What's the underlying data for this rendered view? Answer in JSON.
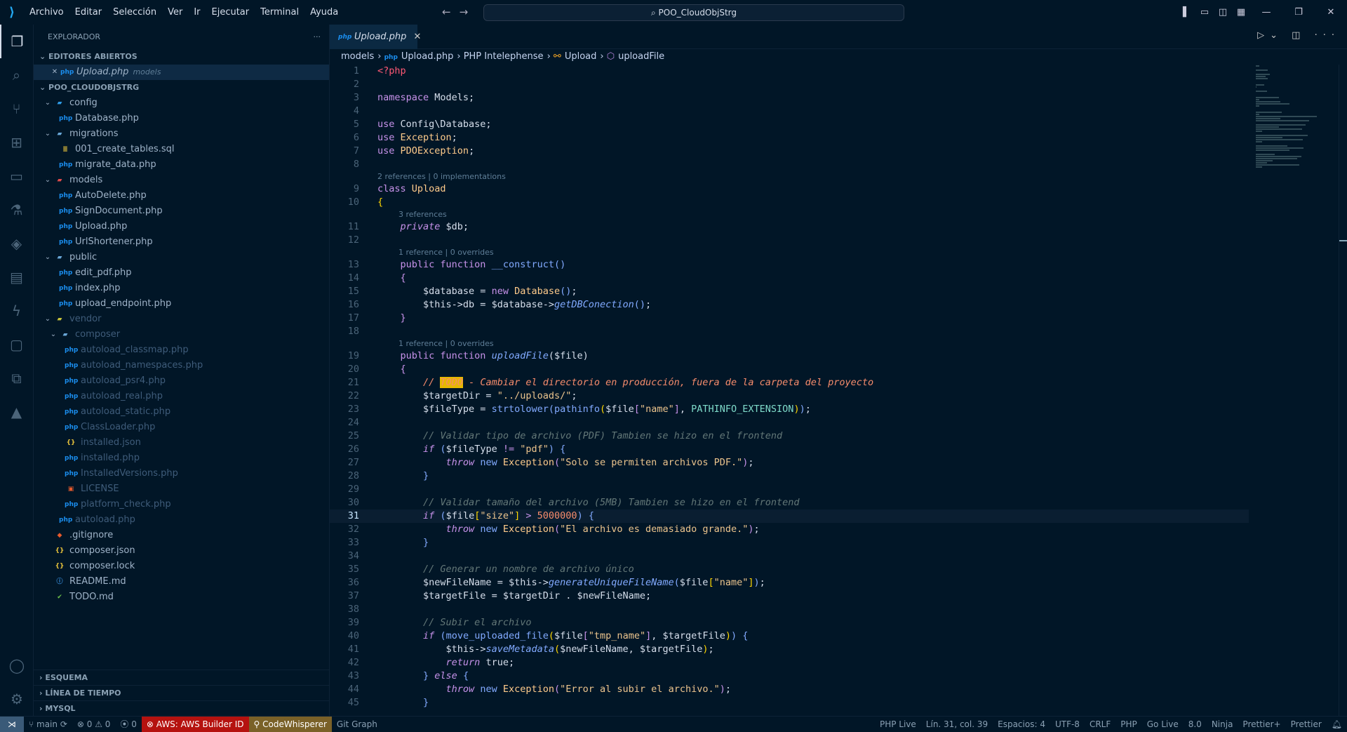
{
  "titlebar": {
    "menu": [
      "Archivo",
      "Editar",
      "Selección",
      "Ver",
      "Ir",
      "Ejecutar",
      "Terminal",
      "Ayuda"
    ],
    "search": "POO_CloudObjStrg"
  },
  "sidebar": {
    "title": "EXPLORADOR",
    "open_editors": {
      "label": "EDITORES ABIERTOS",
      "items": [
        {
          "name": "Upload.php",
          "hint": "models"
        }
      ]
    },
    "project": "POO_CLOUDOBJSTRG",
    "tree": [
      {
        "d": 1,
        "t": "folder",
        "name": "config",
        "open": true,
        "icon": "folder-config"
      },
      {
        "d": 2,
        "t": "php",
        "name": "Database.php"
      },
      {
        "d": 1,
        "t": "folder",
        "name": "migrations",
        "open": true
      },
      {
        "d": 2,
        "t": "sql",
        "name": "001_create_tables.sql"
      },
      {
        "d": 2,
        "t": "php",
        "name": "migrate_data.php"
      },
      {
        "d": 1,
        "t": "folder",
        "name": "models",
        "open": true
      },
      {
        "d": 2,
        "t": "php",
        "name": "AutoDelete.php"
      },
      {
        "d": 2,
        "t": "php",
        "name": "SignDocument.php"
      },
      {
        "d": 2,
        "t": "php",
        "name": "Upload.php"
      },
      {
        "d": 2,
        "t": "php",
        "name": "UrlShortener.php"
      },
      {
        "d": 1,
        "t": "folder",
        "name": "public",
        "open": true
      },
      {
        "d": 2,
        "t": "php",
        "name": "edit_pdf.php"
      },
      {
        "d": 2,
        "t": "php",
        "name": "index.php"
      },
      {
        "d": 2,
        "t": "php",
        "name": "upload_endpoint.php"
      },
      {
        "d": 1,
        "t": "folder",
        "name": "vendor",
        "open": true,
        "dim": true
      },
      {
        "d": 2,
        "t": "folder",
        "name": "composer",
        "open": true,
        "dim": true
      },
      {
        "d": 3,
        "t": "php",
        "name": "autoload_classmap.php",
        "dim": true
      },
      {
        "d": 3,
        "t": "php",
        "name": "autoload_namespaces.php",
        "dim": true
      },
      {
        "d": 3,
        "t": "php",
        "name": "autoload_psr4.php",
        "dim": true
      },
      {
        "d": 3,
        "t": "php",
        "name": "autoload_real.php",
        "dim": true
      },
      {
        "d": 3,
        "t": "php",
        "name": "autoload_static.php",
        "dim": true
      },
      {
        "d": 3,
        "t": "php",
        "name": "ClassLoader.php",
        "dim": true
      },
      {
        "d": 3,
        "t": "json",
        "name": "installed.json",
        "dim": true
      },
      {
        "d": 3,
        "t": "php",
        "name": "installed.php",
        "dim": true
      },
      {
        "d": 3,
        "t": "php",
        "name": "InstalledVersions.php",
        "dim": true
      },
      {
        "d": 3,
        "t": "lic",
        "name": "LICENSE",
        "dim": true
      },
      {
        "d": 3,
        "t": "php",
        "name": "platform_check.php",
        "dim": true
      },
      {
        "d": 2,
        "t": "php",
        "name": "autoload.php",
        "dim": true
      },
      {
        "d": 1,
        "t": "git",
        "name": ".gitignore"
      },
      {
        "d": 1,
        "t": "json",
        "name": "composer.json"
      },
      {
        "d": 1,
        "t": "json",
        "name": "composer.lock"
      },
      {
        "d": 1,
        "t": "info",
        "name": "README.md"
      },
      {
        "d": 1,
        "t": "todo",
        "name": "TODO.md"
      }
    ],
    "bottom_sections": [
      "ESQUEMA",
      "LÍNEA DE TIEMPO",
      "MYSQL"
    ]
  },
  "editor": {
    "tab": "Upload.php",
    "breadcrumb": [
      "models",
      "Upload.php",
      "PHP Intelephense",
      "Upload",
      "uploadFile"
    ],
    "current_line": 31,
    "lines": [
      {
        "n": 1,
        "t": [
          [
            "tag",
            "<?php"
          ]
        ]
      },
      {
        "n": 2,
        "t": []
      },
      {
        "n": 3,
        "t": [
          [
            "kw",
            "namespace "
          ],
          [
            "var",
            "Models;"
          ]
        ]
      },
      {
        "n": 4,
        "t": []
      },
      {
        "n": 5,
        "t": [
          [
            "kw",
            "use "
          ],
          [
            "var",
            "Config\\Database;"
          ]
        ]
      },
      {
        "n": 6,
        "t": [
          [
            "kw",
            "use "
          ],
          [
            "cls",
            "Exception"
          ],
          [
            "p",
            ";"
          ]
        ]
      },
      {
        "n": 7,
        "t": [
          [
            "kw",
            "use "
          ],
          [
            "cls",
            "PDOException"
          ],
          [
            "p",
            ";"
          ]
        ]
      },
      {
        "n": 8,
        "t": []
      },
      {
        "lens": "2 references | 0 implementations",
        "i": 0
      },
      {
        "n": 9,
        "t": [
          [
            "kw",
            "class "
          ],
          [
            "cls",
            "Upload"
          ]
        ]
      },
      {
        "n": 10,
        "t": [
          [
            "b2",
            "{"
          ]
        ]
      },
      {
        "lens": "3 references",
        "i": 1
      },
      {
        "n": 11,
        "t": [
          [
            "p",
            "    "
          ],
          [
            "kwi",
            "private "
          ],
          [
            "var",
            "$db;"
          ]
        ]
      },
      {
        "n": 12,
        "t": []
      },
      {
        "lens": "1 reference | 0 overrides",
        "i": 1
      },
      {
        "n": 13,
        "t": [
          [
            "p",
            "    "
          ],
          [
            "kw",
            "public function "
          ],
          [
            "fn",
            "__construct"
          ],
          [
            "b",
            "()"
          ]
        ]
      },
      {
        "n": 14,
        "t": [
          [
            "p",
            "    "
          ],
          [
            "kw",
            "{"
          ]
        ]
      },
      {
        "n": 15,
        "t": [
          [
            "p",
            "        "
          ],
          [
            "var",
            "$database = "
          ],
          [
            "kw",
            "new "
          ],
          [
            "cls",
            "Database"
          ],
          [
            "b",
            "()"
          ],
          [
            "p",
            ";"
          ]
        ]
      },
      {
        "n": 16,
        "t": [
          [
            "p",
            "        "
          ],
          [
            "var",
            "$this->db = $database->"
          ],
          [
            "fni",
            "getDBConection"
          ],
          [
            "b",
            "()"
          ],
          [
            "p",
            ";"
          ]
        ]
      },
      {
        "n": 17,
        "t": [
          [
            "p",
            "    "
          ],
          [
            "kw",
            "}"
          ]
        ]
      },
      {
        "n": 18,
        "t": []
      },
      {
        "lens": "1 reference | 0 overrides",
        "i": 1
      },
      {
        "n": 19,
        "t": [
          [
            "p",
            "    "
          ],
          [
            "kw",
            "public function "
          ],
          [
            "fni",
            "uploadFile"
          ],
          [
            "p",
            "($file)"
          ]
        ]
      },
      {
        "n": 20,
        "t": [
          [
            "p",
            "    "
          ],
          [
            "kw",
            "{"
          ]
        ]
      },
      {
        "n": 21,
        "t": [
          [
            "p",
            "        "
          ],
          [
            "todo",
            "// "
          ],
          [
            "todoh",
            "TODO"
          ],
          [
            "todo",
            " - Cambiar el directorio en producción, fuera de la carpeta del proyecto"
          ]
        ]
      },
      {
        "n": 22,
        "t": [
          [
            "p",
            "        "
          ],
          [
            "var",
            "$targetDir = "
          ],
          [
            "str",
            "\"../uploads/\""
          ],
          [
            "p",
            ";"
          ]
        ]
      },
      {
        "n": 23,
        "t": [
          [
            "p",
            "        "
          ],
          [
            "var",
            "$fileType = "
          ],
          [
            "fn",
            "strtolower"
          ],
          [
            "b",
            "("
          ],
          [
            "fn",
            "pathinfo"
          ],
          [
            "b2",
            "("
          ],
          [
            "var",
            "$file"
          ],
          [
            "kw",
            "["
          ],
          [
            "str",
            "\"name\""
          ],
          [
            "kw",
            "]"
          ],
          [
            "p",
            ", "
          ],
          [
            "const",
            "PATHINFO_EXTENSION"
          ],
          [
            "b2",
            ")"
          ],
          [
            "b",
            ")"
          ],
          [
            "p",
            ";"
          ]
        ]
      },
      {
        "n": 24,
        "t": []
      },
      {
        "n": 25,
        "t": [
          [
            "p",
            "        "
          ],
          [
            "cm",
            "// Validar tipo de archivo (PDF) Tambien se hizo en el frontend"
          ]
        ]
      },
      {
        "n": 26,
        "t": [
          [
            "p",
            "        "
          ],
          [
            "kwi",
            "if "
          ],
          [
            "b",
            "("
          ],
          [
            "var",
            "$fileType "
          ],
          [
            "kw",
            "!= "
          ],
          [
            "str",
            "\"pdf\""
          ],
          [
            "b",
            ") {"
          ]
        ]
      },
      {
        "n": 27,
        "t": [
          [
            "p",
            "            "
          ],
          [
            "kwi",
            "throw "
          ],
          [
            "fn",
            "new "
          ],
          [
            "cls",
            "Exception"
          ],
          [
            "kw",
            "("
          ],
          [
            "str",
            "\"Solo se permiten archivos PDF.\""
          ],
          [
            "kw",
            ")"
          ],
          [
            "p",
            ";"
          ]
        ]
      },
      {
        "n": 28,
        "t": [
          [
            "p",
            "        "
          ],
          [
            "b",
            "}"
          ]
        ]
      },
      {
        "n": 29,
        "t": []
      },
      {
        "n": 30,
        "t": [
          [
            "p",
            "        "
          ],
          [
            "cm",
            "// Validar tamaño del archivo (5MB) Tambien se hizo en el frontend"
          ]
        ]
      },
      {
        "n": 31,
        "t": [
          [
            "p",
            "        "
          ],
          [
            "kwi",
            "if "
          ],
          [
            "b",
            "("
          ],
          [
            "var",
            "$file"
          ],
          [
            "b2",
            "["
          ],
          [
            "str",
            "\"size\""
          ],
          [
            "b2",
            "]"
          ],
          [
            "kw",
            " > "
          ],
          [
            "num",
            "5000000"
          ],
          [
            "b",
            ") {"
          ]
        ]
      },
      {
        "n": 32,
        "t": [
          [
            "p",
            "            "
          ],
          [
            "kwi",
            "throw "
          ],
          [
            "fn",
            "new "
          ],
          [
            "cls",
            "Exception"
          ],
          [
            "kw",
            "("
          ],
          [
            "str",
            "\"El archivo es demasiado grande.\""
          ],
          [
            "kw",
            ")"
          ],
          [
            "p",
            ";"
          ]
        ]
      },
      {
        "n": 33,
        "t": [
          [
            "p",
            "        "
          ],
          [
            "b",
            "}"
          ]
        ]
      },
      {
        "n": 34,
        "t": []
      },
      {
        "n": 35,
        "t": [
          [
            "p",
            "        "
          ],
          [
            "cm",
            "// Generar un nombre de archivo único"
          ]
        ]
      },
      {
        "n": 36,
        "t": [
          [
            "p",
            "        "
          ],
          [
            "var",
            "$newFileName = $this->"
          ],
          [
            "fni",
            "generateUniqueFileName"
          ],
          [
            "b",
            "("
          ],
          [
            "var",
            "$file"
          ],
          [
            "b2",
            "["
          ],
          [
            "str",
            "\"name\""
          ],
          [
            "b2",
            "]"
          ],
          [
            "b",
            ")"
          ],
          [
            "p",
            ";"
          ]
        ]
      },
      {
        "n": 37,
        "t": [
          [
            "p",
            "        "
          ],
          [
            "var",
            "$targetFile = $targetDir . $newFileName;"
          ]
        ]
      },
      {
        "n": 38,
        "t": []
      },
      {
        "n": 39,
        "t": [
          [
            "p",
            "        "
          ],
          [
            "cm",
            "// Subir el archivo"
          ]
        ]
      },
      {
        "n": 40,
        "t": [
          [
            "p",
            "        "
          ],
          [
            "kwi",
            "if "
          ],
          [
            "b",
            "("
          ],
          [
            "fn",
            "move_uploaded_file"
          ],
          [
            "b2",
            "("
          ],
          [
            "var",
            "$file"
          ],
          [
            "kw",
            "["
          ],
          [
            "str",
            "\"tmp_name\""
          ],
          [
            "kw",
            "]"
          ],
          [
            "p",
            ", $targetFile"
          ],
          [
            "b2",
            ")"
          ],
          [
            "b",
            ") {"
          ]
        ]
      },
      {
        "n": 41,
        "t": [
          [
            "p",
            "            "
          ],
          [
            "var",
            "$this->"
          ],
          [
            "fni",
            "saveMetadata"
          ],
          [
            "b2",
            "("
          ],
          [
            "var",
            "$newFileName, $targetFile"
          ],
          [
            "b2",
            ")"
          ],
          [
            "p",
            ";"
          ]
        ]
      },
      {
        "n": 42,
        "t": [
          [
            "p",
            "            "
          ],
          [
            "kwi",
            "return "
          ],
          [
            "var",
            "true;"
          ]
        ]
      },
      {
        "n": 43,
        "t": [
          [
            "p",
            "        "
          ],
          [
            "b",
            "} "
          ],
          [
            "kwi",
            "else "
          ],
          [
            "b",
            "{"
          ]
        ]
      },
      {
        "n": 44,
        "t": [
          [
            "p",
            "            "
          ],
          [
            "kwi",
            "throw "
          ],
          [
            "fn",
            "new "
          ],
          [
            "cls",
            "Exception"
          ],
          [
            "kw",
            "("
          ],
          [
            "str",
            "\"Error al subir el archivo.\""
          ],
          [
            "kw",
            ")"
          ],
          [
            "p",
            ";"
          ]
        ]
      },
      {
        "n": 45,
        "t": [
          [
            "p",
            "        "
          ],
          [
            "b",
            "}"
          ]
        ]
      }
    ]
  },
  "statusbar": {
    "branch": "main",
    "errors": "0",
    "warnings": "0",
    "ports": "0",
    "aws": "AWS: AWS Builder ID",
    "codewhisperer": "CodeWhisperer",
    "git_graph": "Git Graph",
    "right": [
      "PHP Live",
      "Lín. 31, col. 39",
      "Espacios: 4",
      "UTF-8",
      "CRLF",
      "PHP",
      "Go Live",
      "8.0",
      "Ninja",
      "Prettier+",
      "Prettier"
    ]
  },
  "colors": {
    "background": "#011627",
    "aws": "#b5120f",
    "codewhisperer": "#7a6128",
    "todo_highlight": "#e6b800"
  }
}
